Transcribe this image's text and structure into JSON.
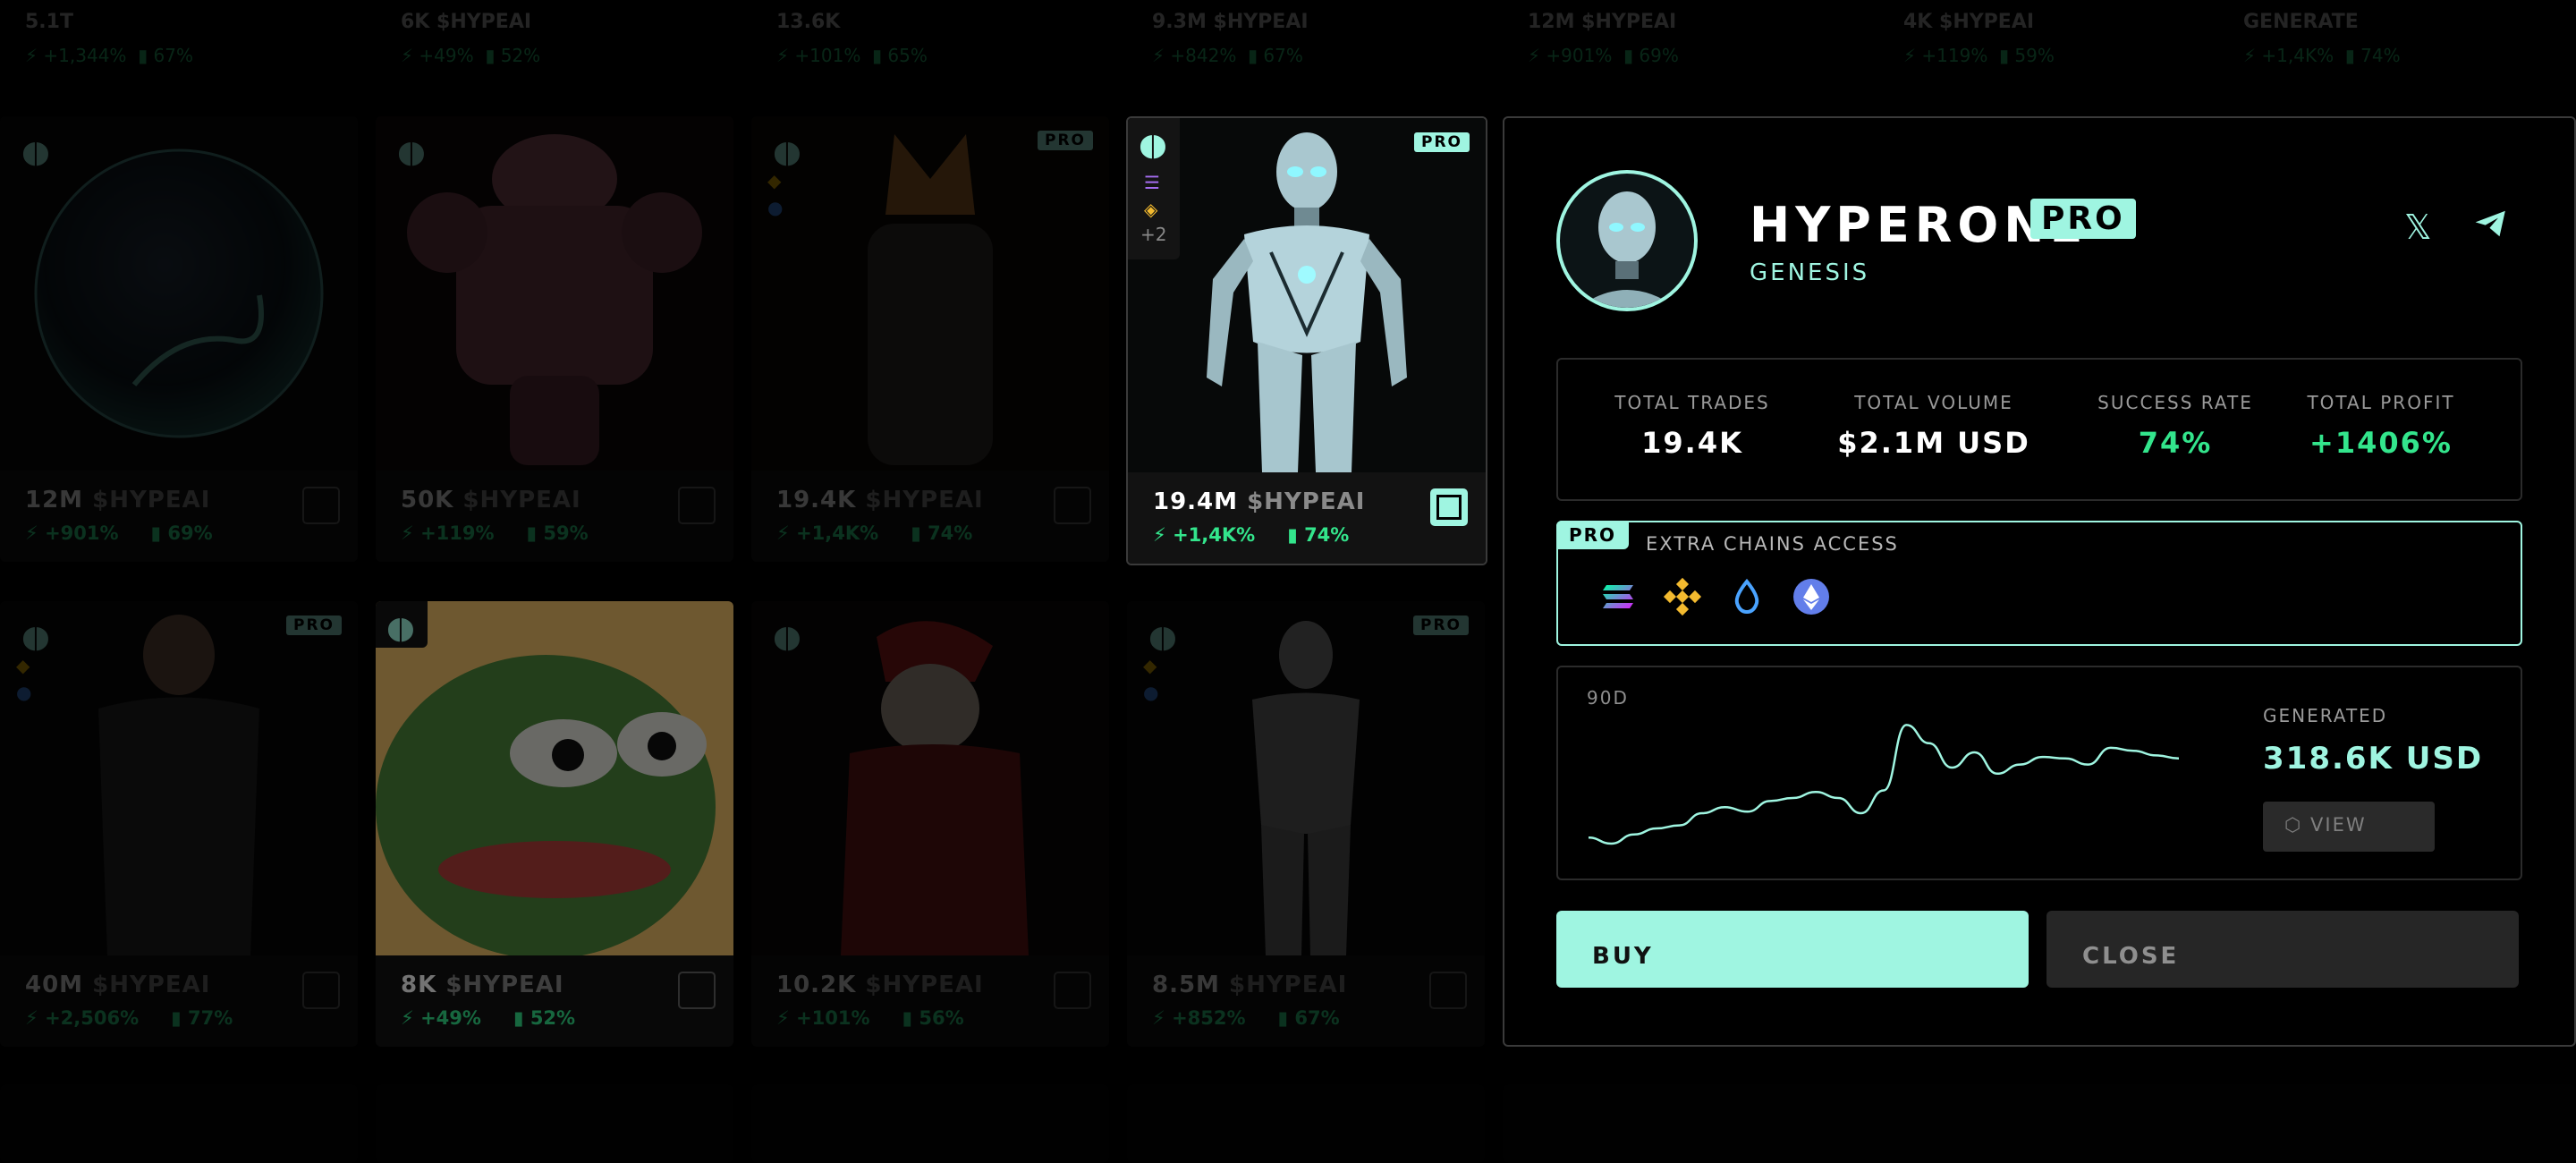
{
  "top_row": [
    {
      "title": "5.1T",
      "change": "+1,344%",
      "rate": "67%"
    },
    {
      "title": "6K $HYPEAI",
      "change": "+49%",
      "rate": "52%"
    },
    {
      "title": "13.6K",
      "change": "+101%",
      "rate": "65%"
    },
    {
      "title": "9.3M $HYPEAI",
      "change": "+842%",
      "rate": "67%"
    },
    {
      "title": "12M $HYPEAI",
      "change": "+901%",
      "rate": "69%"
    },
    {
      "title": "4K $HYPEAI",
      "change": "+119%",
      "rate": "59%"
    },
    {
      "title": "GENERATE",
      "change": "+1,4K%",
      "rate": "74%"
    }
  ],
  "cards": [
    {
      "id": "orb",
      "price": "12M",
      "token": "$HYPEAI",
      "change": "+901%",
      "rate": "69%",
      "pro": false
    },
    {
      "id": "pink-robot",
      "price": "50K",
      "token": "$HYPEAI",
      "change": "+119%",
      "rate": "59%",
      "pro": false
    },
    {
      "id": "fox",
      "price": "19.4K",
      "token": "$HYPEAI",
      "change": "+1,4K%",
      "rate": "74%",
      "pro": true,
      "pro_label": "PRO"
    },
    {
      "id": "hyperone",
      "price": "19.4M",
      "token": "$HYPEAI",
      "change": "+1,4K%",
      "rate": "74%",
      "pro": true,
      "pro_label": "PRO",
      "more_chains": "+2"
    },
    {
      "id": "dark-suit",
      "price": "40M",
      "token": "$HYPEAI",
      "change": "+2,506%",
      "rate": "77%",
      "pro": true,
      "pro_label": "PRO"
    },
    {
      "id": "pepe",
      "price": "8K",
      "token": "$HYPEAI",
      "change": "+49%",
      "rate": "52%",
      "pro": false
    },
    {
      "id": "santa",
      "price": "10.2K",
      "token": "$HYPEAI",
      "change": "+101%",
      "rate": "56%",
      "pro": false
    },
    {
      "id": "silver-woman",
      "price": "8.5M",
      "token": "$HYPEAI",
      "change": "+852%",
      "rate": "67%",
      "pro": true,
      "pro_label": "PRO"
    }
  ],
  "detail": {
    "name": "HYPERONE",
    "badge": "PRO",
    "subtitle": "GENESIS",
    "social": {
      "x_icon": "x-icon",
      "telegram_icon": "telegram-icon"
    },
    "stats": [
      {
        "label": "TOTAL TRADES",
        "value": "19.4K",
        "color": "#ffffff"
      },
      {
        "label": "TOTAL VOLUME",
        "value": "$2.1M USD",
        "color": "#ffffff"
      },
      {
        "label": "SUCCESS RATE",
        "value": "74%",
        "color": "#33e58c"
      },
      {
        "label": "TOTAL PROFIT",
        "value": "+1406%",
        "color": "#33e58c"
      }
    ],
    "chains": {
      "tag": "PRO",
      "title": "EXTRA CHAINS ACCESS",
      "icons": [
        "solana-icon",
        "bnb-icon",
        "drop-icon",
        "ethereum-icon"
      ]
    },
    "chart": {
      "period": "90D",
      "generated_label": "GENERATED",
      "generated_value": "318.6K USD",
      "view_label": "VIEW"
    },
    "buy_label": "BUY",
    "close_label": "CLOSE"
  },
  "colors": {
    "accent": "#9ff5e1",
    "positive": "#33e58c",
    "background": "#000000"
  },
  "chart_data": {
    "type": "line",
    "series": [
      {
        "values": [
          14,
          10,
          16,
          20,
          22,
          30,
          34,
          31,
          38,
          40,
          44,
          40,
          30,
          45,
          88,
          76,
          60,
          70,
          56,
          62,
          67,
          66,
          62,
          73,
          71,
          68,
          66
        ]
      }
    ],
    "xlabel": "",
    "ylabel": "",
    "grid": false
  }
}
